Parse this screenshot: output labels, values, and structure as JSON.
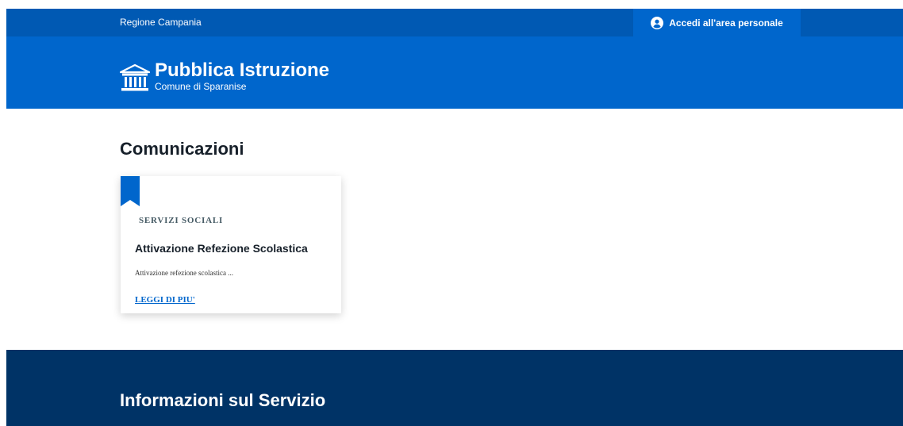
{
  "topbar": {
    "region": "Regione Campania",
    "login": "Accedi all'area personale"
  },
  "header": {
    "title": "Pubblica Istruzione",
    "subtitle": "Comune di Sparanise"
  },
  "main": {
    "section_title": "Comunicazioni",
    "card": {
      "category": "SERVIZI SOCIALI",
      "title": "Attivazione Refezione Scolastica",
      "text": "Attivazione refezione scolastica ...",
      "link": "LEGGI DI PIU'"
    }
  },
  "footer": {
    "title": "Informazioni sul Servizio"
  },
  "icons": {
    "login": "user-circle-icon",
    "brand": "building-icon",
    "card_marker": "bookmark-icon"
  },
  "colors": {
    "topbar": "#0059b3",
    "header": "#0066cc",
    "footer": "#003366",
    "link": "#0066cc"
  }
}
